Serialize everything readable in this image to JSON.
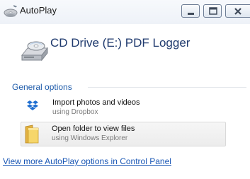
{
  "window": {
    "title": "AutoPlay",
    "controls": [
      "minimize-icon",
      "maximize-icon",
      "close-icon"
    ]
  },
  "header": {
    "drive_title": "CD Drive (E:) PDF Logger",
    "drive_icon": "cd-drive-icon"
  },
  "section": {
    "label": "General options"
  },
  "options": [
    {
      "title": "Import photos and videos",
      "subtitle": "using Dropbox",
      "icon": "dropbox-icon"
    },
    {
      "title": "Open folder to view files",
      "subtitle": "using Windows Explorer",
      "icon": "folder-icon"
    }
  ],
  "footer": {
    "link_text": "View more AutoPlay options in Control Panel"
  },
  "colors": {
    "link": "#1a57b5",
    "section_label": "#1e5baa",
    "drive_title": "#1f3a6e",
    "dropbox": "#1f6fd1"
  }
}
